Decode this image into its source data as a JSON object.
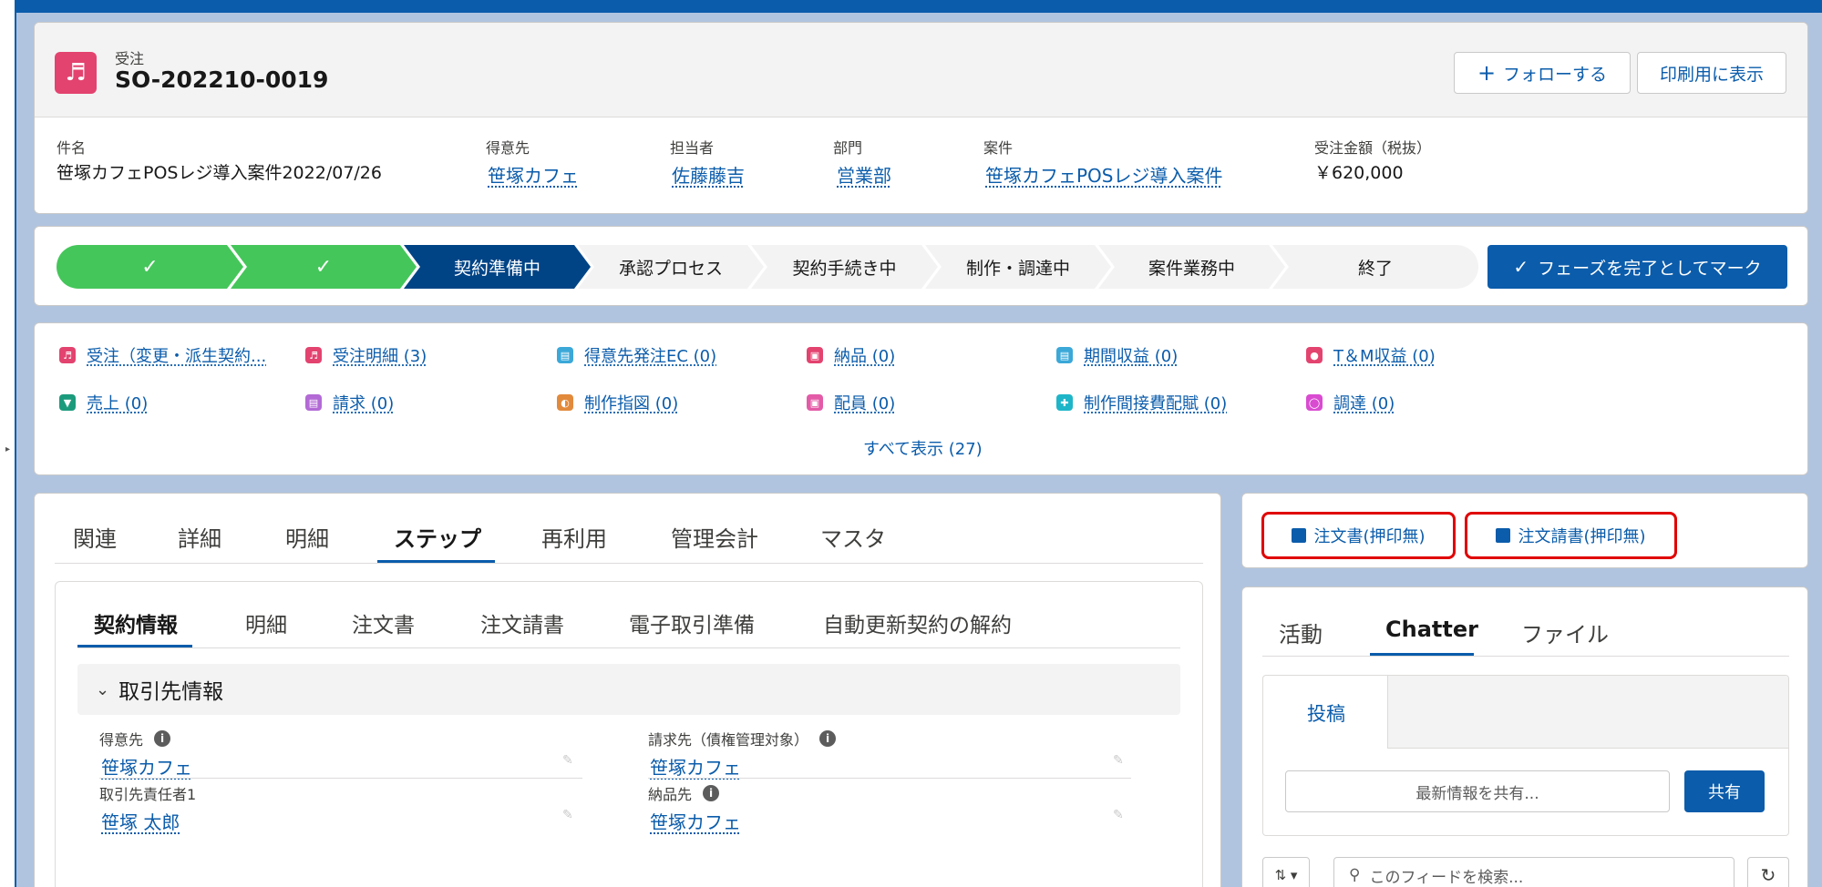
{
  "header": {
    "object_type": "受注",
    "record_name": "SO-202210-0019",
    "follow_label": "フォローする",
    "print_label": "印刷用に表示",
    "fields": [
      {
        "label": "件名",
        "value": "笹塚カフェPOSレジ導入案件2022/07/26"
      },
      {
        "label": "得意先",
        "value": "笹塚カフェ"
      },
      {
        "label": "担当者",
        "value": "佐藤藤吉"
      },
      {
        "label": "部門",
        "value": "営業部"
      },
      {
        "label": "案件",
        "value": "笹塚カフェPOSレジ導入案件"
      },
      {
        "label": "受注金額（税抜）",
        "value": "￥620,000"
      }
    ]
  },
  "path": {
    "steps": [
      "",
      "",
      "契約準備中",
      "承認プロセス",
      "契約手続き中",
      "制作・調達中",
      "案件業務中",
      "終了"
    ],
    "complete_button": "フェーズを完了としてマーク",
    "colors": {
      "complete": "#45c65a",
      "current": "#014486",
      "incomplete": "#f3f3f3"
    }
  },
  "related": {
    "items": [
      {
        "label": "受注（変更・派生契約...",
        "color": "#e3436f"
      },
      {
        "label": "受注明細 (3)",
        "color": "#e3436f"
      },
      {
        "label": "得意先発注EC (0)",
        "color": "#3ba8d8"
      },
      {
        "label": "納品 (0)",
        "color": "#e3436f"
      },
      {
        "label": "期間収益 (0)",
        "color": "#3ba8d8"
      },
      {
        "label": "T＆M収益 (0)",
        "color": "#e3436f"
      },
      {
        "label": "売上 (0)",
        "color": "#1c9b7c"
      },
      {
        "label": "請求 (0)",
        "color": "#b36ad6"
      },
      {
        "label": "制作指図 (0)",
        "color": "#e28a3c"
      },
      {
        "label": "配員 (0)",
        "color": "#e35ba7"
      },
      {
        "label": "制作間接費配賦 (0)",
        "color": "#1fb5c8"
      },
      {
        "label": "調達 (0)",
        "color": "#d94bd1"
      }
    ],
    "view_all": "すべて表示 (27)"
  },
  "main_tabs": [
    "関連",
    "詳細",
    "明細",
    "ステップ",
    "再利用",
    "管理会計",
    "マスタ"
  ],
  "sub_tabs": [
    "契約情報",
    "明細",
    "注文書",
    "注文請書",
    "電子取引準備",
    "自動更新契約の解約"
  ],
  "section": {
    "title": "取引先情報",
    "fields": [
      {
        "label": "得意先",
        "value": "笹塚カフェ"
      },
      {
        "label": "請求先（債権管理対象）",
        "value": "笹塚カフェ"
      },
      {
        "label": "取引先責任者1",
        "value": "笹塚 太郎"
      },
      {
        "label": "納品先",
        "value": "笹塚カフェ"
      }
    ]
  },
  "actions": {
    "purchase_order": "注文書(押印無)",
    "order_acceptance": "注文請書(押印無)"
  },
  "feed": {
    "tabs": [
      "活動",
      "Chatter",
      "ファイル"
    ],
    "post_tab": "投稿",
    "share_placeholder": "最新情報を共有...",
    "share_button": "共有",
    "search_placeholder": "このフィードを検索..."
  }
}
